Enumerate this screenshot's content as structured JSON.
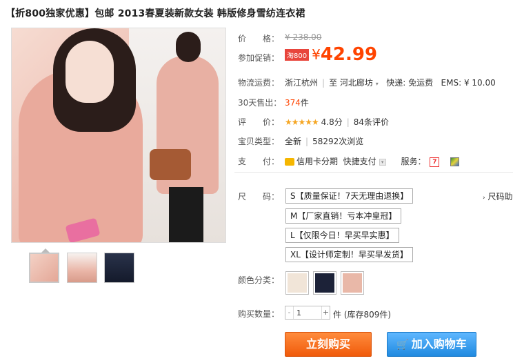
{
  "product": {
    "title": "【折800独家优惠】包邮 2013春夏装新款女装 韩版修身雪纺连衣裙"
  },
  "price": {
    "label": "价　　格：",
    "original": "¥ 238.00",
    "promo_label": "参加促销：",
    "promo_tag": "淘800",
    "promo_yen": "¥",
    "promo_value": "42.99"
  },
  "shipping": {
    "label": "物流运费：",
    "from": "浙江杭州",
    "to_prefix": "至",
    "to": "河北廊坊",
    "express": "快递: 免运费",
    "ems": "EMS: ¥ 10.00"
  },
  "sales": {
    "label": "30天售出：",
    "count": "374",
    "unit": "件"
  },
  "rating": {
    "label": "评　　价：",
    "stars": "★★★★★",
    "score": "4.8分",
    "reviews": "84条评价"
  },
  "type": {
    "label": "宝贝类型：",
    "condition": "全新",
    "views": "58292次浏览"
  },
  "payment": {
    "label": "支　　付：",
    "credit": "信用卡分期",
    "quick": "快捷支付",
    "service_label": "服务："
  },
  "size": {
    "label": "尺　　码：",
    "options": [
      "S【质量保证！7天无理由退换】",
      "M【厂家直销！亏本冲皇冠】",
      "L【仅限今日！早买早实惠】",
      "XL【设计师定制！早买早发货】"
    ],
    "guide": "尺码助"
  },
  "color": {
    "label": "颜色分类：",
    "swatches": [
      "#f1e5d8",
      "#1c2238",
      "#e9b8a8"
    ]
  },
  "quantity": {
    "label": "购买数量：",
    "value": "1",
    "minus": "-",
    "plus": "+",
    "unit": "件 (库存809件)"
  },
  "actions": {
    "buy_now": "立刻购买",
    "add_to_cart": "加入购物车"
  }
}
